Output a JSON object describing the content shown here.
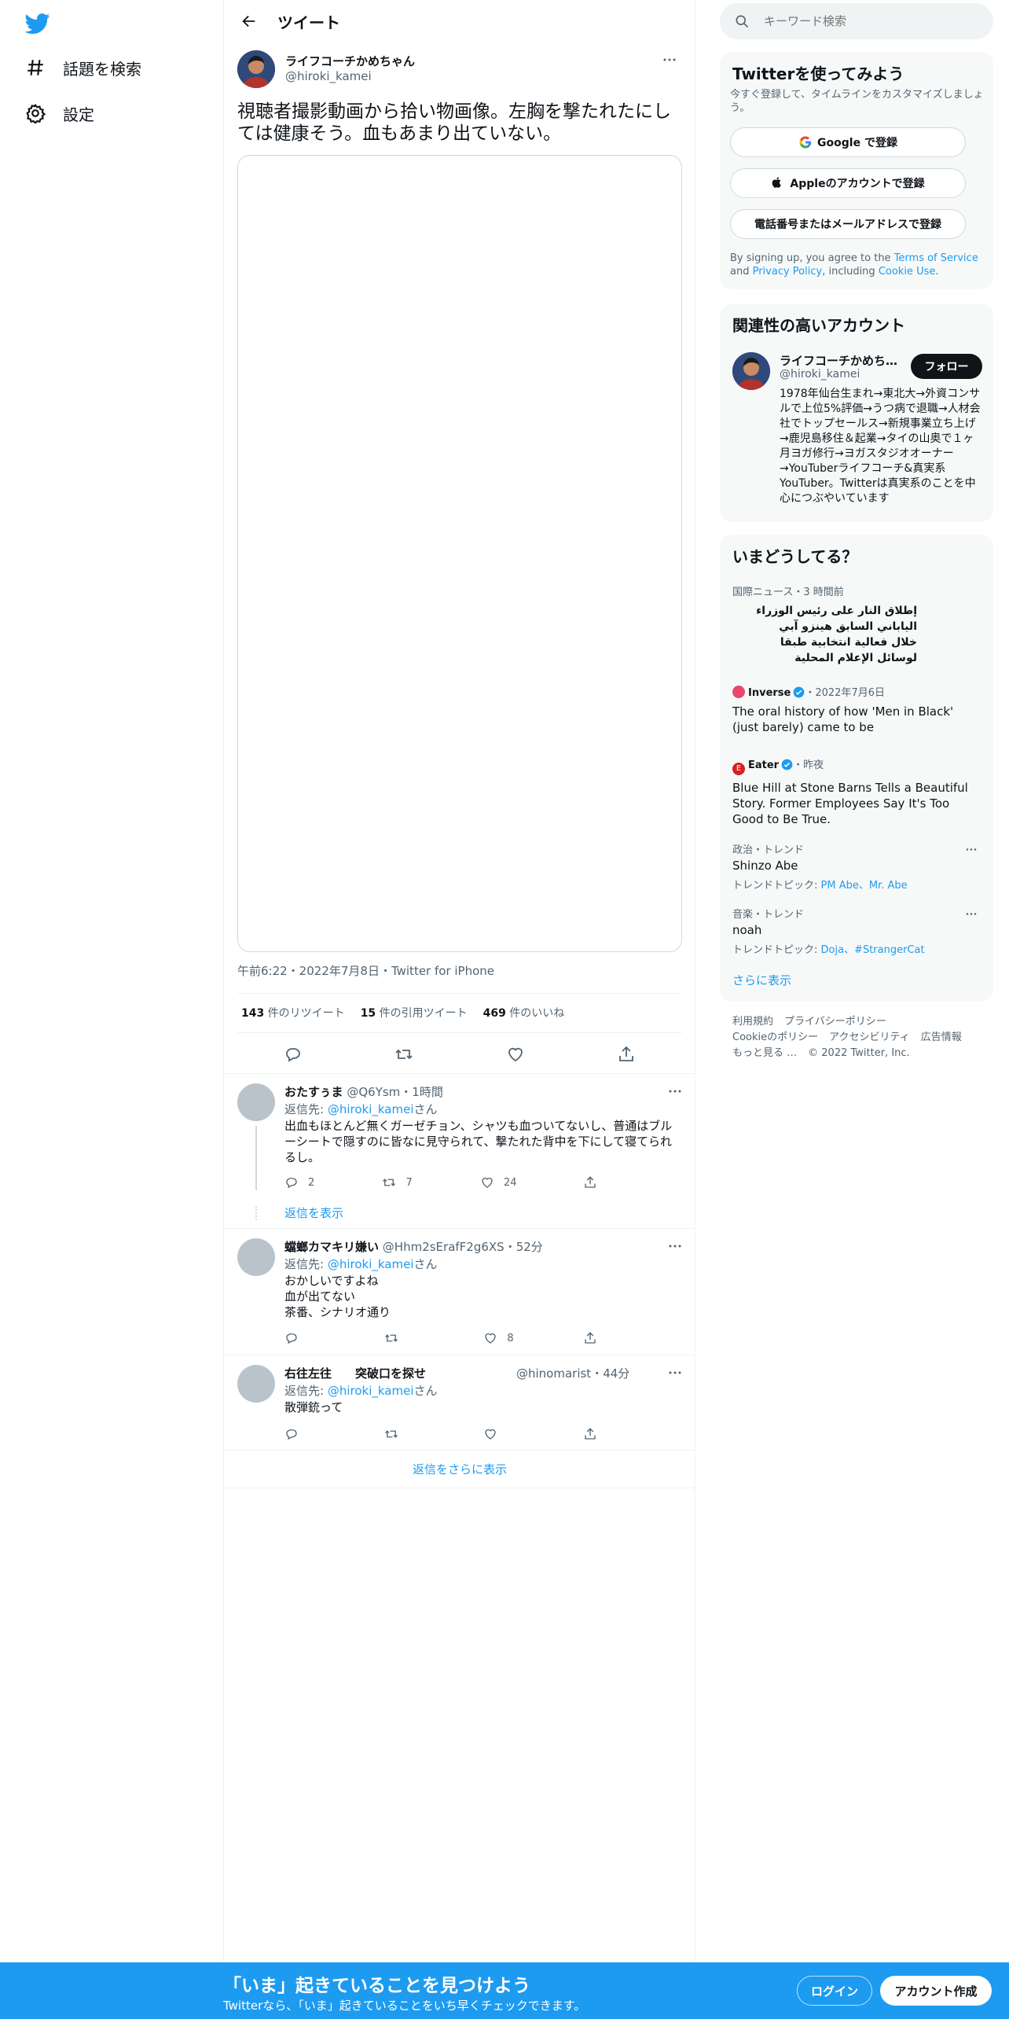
{
  "nav": {
    "explore_label": "話題を検索",
    "settings_label": "設定"
  },
  "header": {
    "title": "ツイート"
  },
  "tweet": {
    "name": "ライフコーチかめちゃん",
    "handle": "@hiroki_kamei",
    "text": "視聴者撮影動画から拾い物画像。左胸を撃たれたにしては健康そう。血もあまり出ていない。",
    "meta": "午前6:22・2022年7月8日・Twitter for iPhone",
    "retweets": "143",
    "retweets_label": " 件のリツイート",
    "quotes": "15",
    "quotes_label": " 件の引用ツイート",
    "likes": "469",
    "likes_label": " 件のいいね"
  },
  "replies": [
    {
      "name": "おたすぅま",
      "handle": "@Q6Ysm",
      "time": "・1時間",
      "reply_prefix": "返信先: ",
      "reply_to": "@hiroki_kamei",
      "reply_suffix": "さん",
      "body": "出血もほとんど無くガーゼチョン、シャツも血ついてないし、普通はブルーシートで隠すのに皆なに見守られて、撃たれた背中を下にして寝てられるし。",
      "reply_count": "2",
      "retweet_count": "7",
      "like_count": "24",
      "show_replies": "返信を表示"
    },
    {
      "name": "蟷螂カマキリ嫌い",
      "handle": "@Hhm2sErafF2g6XS",
      "time": "・52分",
      "reply_prefix": "返信先: ",
      "reply_to": "@hiroki_kamei",
      "reply_suffix": "さん",
      "body_lines": [
        "おかしいですよね",
        "血が出てない",
        "茶番、シナリオ通り"
      ],
      "reply_count": "",
      "retweet_count": "",
      "like_count": "8"
    },
    {
      "name": "右往左往　　突破口を探せ",
      "handle": "@hinomarist",
      "time": "・44分",
      "reply_prefix": "返信先: ",
      "reply_to": "@hiroki_kamei",
      "reply_suffix": "さん",
      "body": "散弾銃って",
      "reply_count": "",
      "retweet_count": "",
      "like_count": ""
    }
  ],
  "more_replies": "返信をさらに表示",
  "search": {
    "placeholder": "キーワード検索"
  },
  "signup_card": {
    "title": "Twitterを使ってみよう",
    "subtitle": "今すぐ登録して、タイムラインをカスタマイズしましょう。",
    "google": "Google で登録",
    "apple": "Appleのアカウントで登録",
    "phone": "電話番号またはメールアドレスで登録",
    "terms_1": "By signing up, you agree to the ",
    "terms_link": "Terms of Service",
    "terms_2": " and ",
    "privacy_link": "Privacy Policy",
    "terms_3": ", including ",
    "cookie_link": "Cookie Use",
    "terms_4": "."
  },
  "related_card": {
    "title": "関連性の高いアカウント",
    "name": "ライフコーチかめち…",
    "handle": "@hiroki_kamei",
    "follow": "フォロー",
    "bio": "1978年仙台生まれ→東北大→外資コンサルで上位5%評価→うつ病で退職→人材会社でトップセールス→新規事業立ち上げ→鹿児島移住＆起業→タイの山奥で１ヶ月ヨガ修行→ヨガスタジオオーナー→YouTuberライフコーチ&真実系YouTuber。Twitterは真実系のことを中心につぶやいています"
  },
  "trends_card": {
    "title": "いまどうしてる？",
    "items": [
      {
        "meta": "国際ニュース・3 時間前",
        "title_lines": [
          "إطلاق النار على رئيس الوزراء",
          "الياباني السابق هينزو آبي",
          "خلال فعالية انتخابية طبقا",
          "لوسائل الإعلام المحلية"
        ]
      },
      {
        "source": "Inverse",
        "meta": "・2022年7月6日",
        "title": "The oral history of how 'Men in Black' (just barely) came to be"
      },
      {
        "source": "Eater",
        "meta": "・昨夜",
        "title": "Blue Hill at Stone Barns Tells a Beautiful Story. Former Employees Say It's Too Good to Be True."
      },
      {
        "meta": "政治・トレンド",
        "title": "Shinzo Abe",
        "topic_label": "トレンドトピック: ",
        "topics": "PM Abe、Mr. Abe"
      },
      {
        "meta": "音楽・トレンド",
        "title": "noah",
        "topic_label": "トレンドトピック: ",
        "topics": "Doja、#StrangerCat"
      }
    ],
    "show_more": "さらに表示"
  },
  "footer": {
    "line1": [
      "利用規約",
      "プライバシーポリシー"
    ],
    "line2": [
      "Cookieのポリシー",
      "アクセシビリティ",
      "広告情報"
    ],
    "line3": [
      "もっと見る …",
      "© 2022 Twitter, Inc."
    ]
  },
  "banner": {
    "title": "「いま」起きていることを見つけよう",
    "subtitle": "Twitterなら、「いま」起きていることをいち早くチェックできます。",
    "login": "ログイン",
    "signup": "アカウント作成"
  },
  "colors": {
    "accent": "#1d9bf0",
    "text": "#0f1419",
    "muted": "#536471",
    "card_bg": "#f7f9f9"
  }
}
